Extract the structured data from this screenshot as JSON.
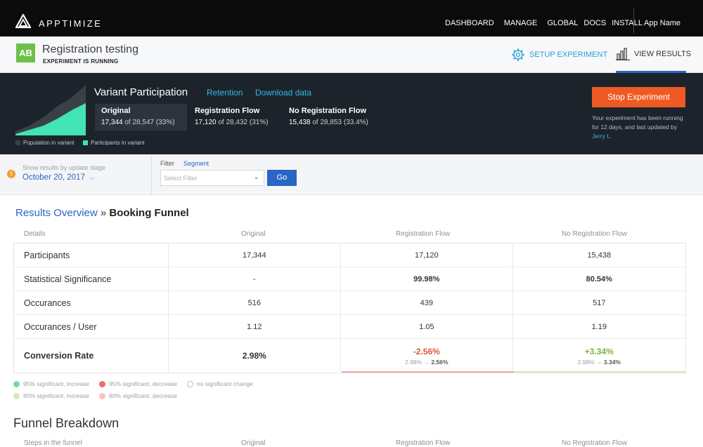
{
  "nav": {
    "brand": "APPTIMIZE",
    "links": [
      "DASHBOARD",
      "MANAGE",
      "GLOBAL",
      "DOCS",
      "INSTALL"
    ],
    "app_name": "App Name"
  },
  "experiment": {
    "badge": "AB",
    "title": "Registration testing",
    "status": "EXPERIMENT IS RUNNING",
    "setup_label": "SETUP EXPERIMENT",
    "view_results_label": "VIEW RESULTS"
  },
  "participation": {
    "title": "Variant Participation",
    "retention_link": "Retention",
    "download_link": "Download data",
    "legend_population": "Population in variant",
    "legend_participants": "Participants in variant",
    "variants": [
      {
        "name": "Original",
        "count": "17,344",
        "rest": "of 28,547 (33%)"
      },
      {
        "name": "Registration Flow",
        "count": "17,120",
        "rest": "of 28,432 (31%)"
      },
      {
        "name": "No Registration Flow",
        "count": "15,438",
        "rest": "of 28,853 (33.4%)"
      }
    ],
    "stop_button": "Stop Experiment",
    "note_prefix": "Your experiment has been running for 12 days, and last updated by ",
    "note_user": "Jerry L."
  },
  "filters": {
    "stage_label": "Show results by update stage",
    "stage_value": "October 20, 2017",
    "filter_label": "Filter",
    "segment_link": "Segment",
    "select_placeholder": "Select Filter",
    "go_button": "Go"
  },
  "results": {
    "crumb": "Results Overview",
    "separator": "»",
    "current": "Booking Funnel",
    "headers": [
      "Details",
      "Original",
      "Registration Flow",
      "No Registration Flow"
    ],
    "rows": [
      {
        "label": "Participants",
        "original": "17,344",
        "reg": "17,120",
        "noreg": "15,438"
      },
      {
        "label": "Statistical Significance",
        "original": "-",
        "reg": "99.98%",
        "noreg": "80.54%"
      },
      {
        "label": "Occurances",
        "original": "516",
        "reg": "439",
        "noreg": "517"
      },
      {
        "label": "Occurances / User",
        "original": "1.12",
        "reg": "1.05",
        "noreg": "1.19"
      }
    ],
    "conversion": {
      "label": "Conversion Rate",
      "original": "2.98%",
      "reg_change": "-2.56%",
      "reg_from": "2.98%",
      "reg_arrow": "→",
      "reg_to": "2.56%",
      "noreg_change": "+3.34%",
      "noreg_from": "2.98%",
      "noreg_arrow": "→",
      "noreg_to": "3.34%"
    },
    "legend": [
      "95% significant, increase",
      "95% significant, decrease",
      "no significant change",
      "80% significant, increase",
      "80% significant, decrease"
    ],
    "legend_colors": {
      "inc95": "#7fd6a4",
      "dec95": "#f06b6b",
      "inc80": "#d7e9b4",
      "dec80": "#f8c4bc"
    }
  },
  "funnel": {
    "title": "Funnel Breakdown",
    "headers": [
      "Steps in the funnel",
      "Original",
      "Registration Flow",
      "No Registration Flow"
    ]
  },
  "colors": {
    "accent_blue": "#2a64c5",
    "link_cyan": "#35b8e8",
    "stop_orange": "#ef5a24",
    "green_badge": "#6cc04a",
    "negative": "#e0583a",
    "positive": "#7cb342"
  }
}
